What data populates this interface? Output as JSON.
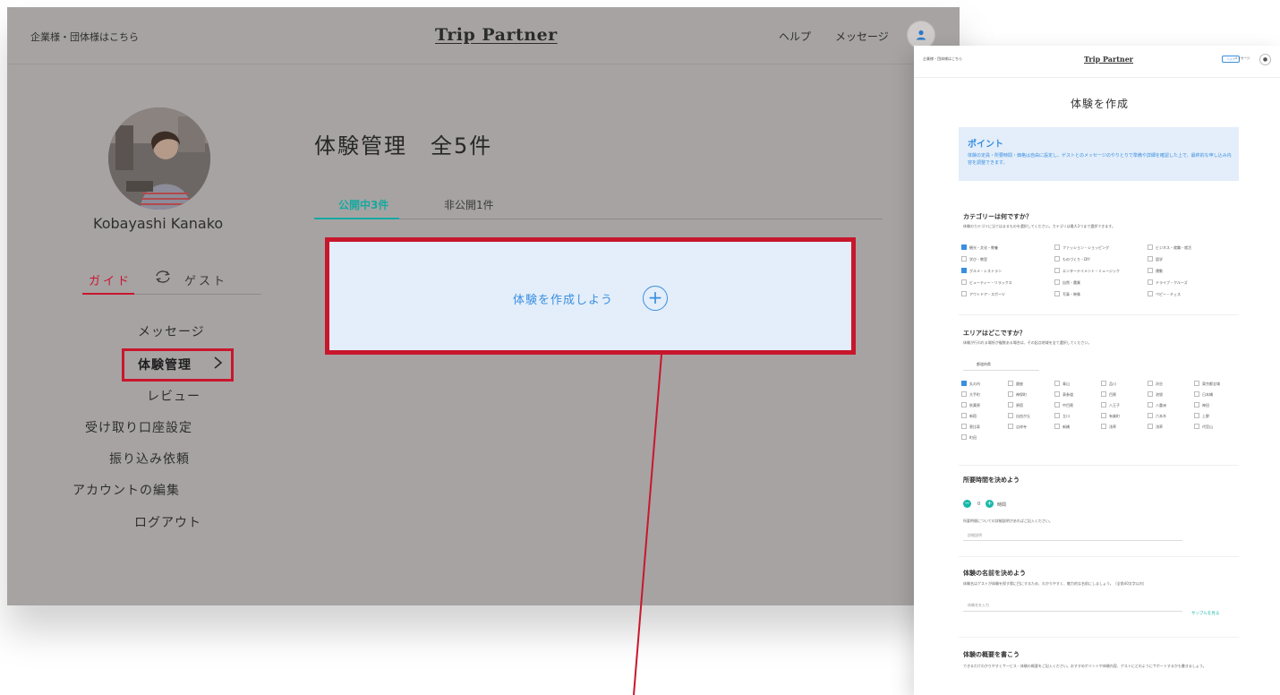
{
  "colors": {
    "accent_red": "#c8172d",
    "accent_teal": "#17a9a0",
    "accent_blue": "#3a8ee0",
    "dim_overlay": "#a7a3a3"
  },
  "main_window": {
    "header": {
      "corporate_link": "企業様・団体様はこちら",
      "logo": "Trip Partner",
      "help": "ヘルプ",
      "messages": "メッセージ",
      "avatar_icon": "user-icon"
    },
    "profile": {
      "name": "Kobayashi Kanako",
      "mode_guide": "ガイド",
      "mode_guest": "ゲスト",
      "swap_icon": "swap-icon"
    },
    "menu": {
      "messages": "メッセージ",
      "experience_management": "体験管理",
      "reviews": "レビュー",
      "payout_settings": "受け取り口座設定",
      "transfer_request": "振り込み依頼",
      "edit_account": "アカウントの編集",
      "logout": "ログアウト"
    },
    "page": {
      "title": "体験管理　全5件",
      "tab_public": "公開中3件",
      "tab_private": "非公開1件",
      "create_label": "体験を作成しよう",
      "create_icon": "+"
    }
  },
  "preview_window": {
    "header": {
      "corporate_link": "企業様・団体様はこちら",
      "logo": "Trip Partner",
      "help": "ヘルプ",
      "messages": "メッセージ",
      "avatar_icon": "user-icon"
    },
    "title": "体験を作成",
    "point": {
      "heading": "ポイント",
      "text": "体験の定員・所要時間・価格は自由に設定し、ゲストとのメッセージのやりとりで準備や詳細を確認した上で、最終的な申し込み内容を調整できます。"
    },
    "category": {
      "heading": "カテゴリーは何ですか？",
      "sub": "体験のカテゴリに当てはまるものを選択してください。カテゴリは最大3つまで選択できます。",
      "options": [
        {
          "label": "観光・文化・教養",
          "checked": true
        },
        {
          "label": "ファッション・ショッピング",
          "checked": false
        },
        {
          "label": "ビジネス・就職・就活",
          "checked": false
        },
        {
          "label": "学び・教室",
          "checked": false
        },
        {
          "label": "ものづくり・DIY",
          "checked": false
        },
        {
          "label": "語学",
          "checked": false
        },
        {
          "label": "グルメ・レストラン",
          "checked": true
        },
        {
          "label": "エンターテイメント・ミュージック",
          "checked": false
        },
        {
          "label": "運動",
          "checked": false
        },
        {
          "label": "ビューティー・リラックス",
          "checked": false
        },
        {
          "label": "自然・農業",
          "checked": false
        },
        {
          "label": "ドライブ・クルーズ",
          "checked": false
        },
        {
          "label": "アウトドア・スポーツ",
          "checked": false
        },
        {
          "label": "写真・映像",
          "checked": false
        },
        {
          "label": "ペピー・チェス",
          "checked": false
        }
      ]
    },
    "area": {
      "heading": "エリアはどこですか？",
      "sub": "体験が行われる場所が複数ある場合は、その起点地域を全て選択してください。",
      "prefecture_label": "都道府県",
      "options": [
        {
          "label": "丸の内",
          "checked": true
        },
        {
          "label": "銀座",
          "checked": false
        },
        {
          "label": "青山",
          "checked": false
        },
        {
          "label": "品川",
          "checked": false
        },
        {
          "label": "渋谷",
          "checked": false
        },
        {
          "label": "東京都全域",
          "checked": false
        },
        {
          "label": "大手町",
          "checked": false
        },
        {
          "label": "神保町",
          "checked": false
        },
        {
          "label": "表参道",
          "checked": false
        },
        {
          "label": "目黒",
          "checked": false
        },
        {
          "label": "池袋",
          "checked": false
        },
        {
          "label": "日本橋",
          "checked": false
        },
        {
          "label": "秋葉原",
          "checked": false
        },
        {
          "label": "原宿",
          "checked": false
        },
        {
          "label": "中目黒",
          "checked": false
        },
        {
          "label": "八王子",
          "checked": false
        },
        {
          "label": "八重洲",
          "checked": false
        },
        {
          "label": "神田",
          "checked": false
        },
        {
          "label": "新宿",
          "checked": false
        },
        {
          "label": "自由が丘",
          "checked": false
        },
        {
          "label": "立川",
          "checked": false
        },
        {
          "label": "有楽町",
          "checked": false
        },
        {
          "label": "六本木",
          "checked": false
        },
        {
          "label": "上野",
          "checked": false
        },
        {
          "label": "恵比寿",
          "checked": false
        },
        {
          "label": "吉祥寺",
          "checked": false
        },
        {
          "label": "新橋",
          "checked": false
        },
        {
          "label": "浅草",
          "checked": false
        },
        {
          "label": "浅草",
          "checked": false
        },
        {
          "label": "代官山",
          "checked": false
        },
        {
          "label": "町田",
          "checked": false
        }
      ]
    },
    "duration": {
      "heading": "所要時間を決めよう",
      "value": "0",
      "unit": "時間",
      "sub": "所要時間についての詳細説明があればご記入ください。",
      "placeholder": "詳細説明"
    },
    "name": {
      "heading": "体験の名前を決めよう",
      "sub": "体験名はゲストが体験を探す際に目にするため、わかりやすく、魅力的な名前にしましょう。（全角40文字以内）",
      "placeholder": "体験名を入力",
      "sample_link": "サンプルを見る"
    },
    "summary": {
      "heading": "体験の概要を書こう",
      "sub": "できるだけわかりやすくサービス・体験の概要をご記入ください。おすすめポイントや体験内容、ゲストにどのようにサポートするかも書きましょう。"
    }
  }
}
